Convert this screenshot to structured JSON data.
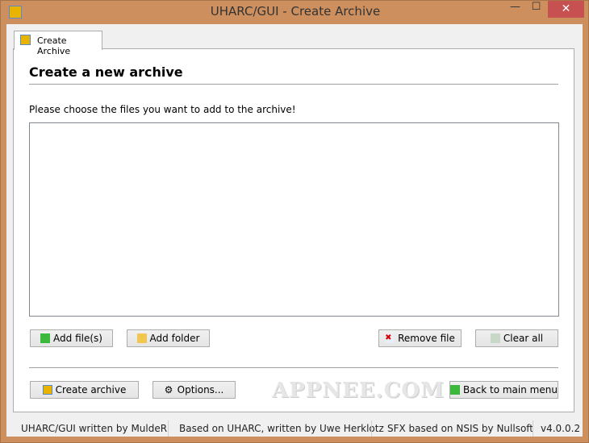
{
  "window": {
    "title": "UHARC/GUI - Create Archive",
    "minimize": "—",
    "maximize": "☐",
    "close": "✕"
  },
  "tab": {
    "label": "Create Archive"
  },
  "main": {
    "heading": "Create a new archive",
    "instruction": "Please choose the files you want to add to the archive!",
    "files": []
  },
  "buttons": {
    "add_files": "Add file(s)",
    "add_folder": "Add folder",
    "remove_file": "Remove file",
    "clear_all": "Clear all",
    "create_archive": "Create archive",
    "options": "Options...",
    "back": "Back to main menu"
  },
  "watermark": "APPNEE.COM",
  "status": [
    "UHARC/GUI written by MuldeR",
    "Based on UHARC, written by Uwe Herklotz",
    "SFX based on NSIS by Nullsoft",
    "v4.0.0.2"
  ]
}
